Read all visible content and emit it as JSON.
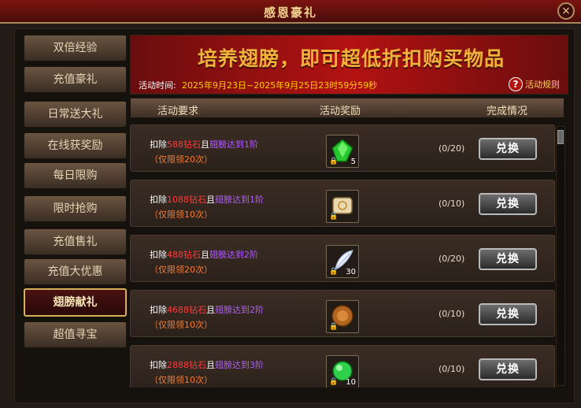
{
  "window": {
    "title": "感恩豪礼",
    "close_label": "×"
  },
  "sidebar": {
    "items": [
      {
        "label": "双倍经验",
        "active": false
      },
      {
        "label": "充值豪礼",
        "active": false
      },
      {
        "label": "日常送大礼",
        "active": false
      },
      {
        "label": "在线获奖励",
        "active": false
      },
      {
        "label": "每日限购",
        "active": false
      },
      {
        "label": "限时抢购",
        "active": false
      },
      {
        "label": "充值售礼",
        "active": false
      },
      {
        "label": "充值大优惠",
        "active": false
      },
      {
        "label": "翅膀献礼",
        "active": true
      },
      {
        "label": "超值寻宝",
        "active": false
      }
    ]
  },
  "banner": {
    "headline": "培养翅膀，即可超低折扣购买物品",
    "time_label": "活动时间:",
    "time_value": "2025年9月23日~2025年9月25日23时59分59秒",
    "rules_label": "活动规则",
    "rules_icon": "question-icon"
  },
  "columns": {
    "requirement": "活动要求",
    "reward": "活动奖励",
    "status": "完成情况"
  },
  "rows": [
    {
      "prefix": "扣除",
      "amount": "588钻石",
      "mid": "且",
      "wing": "翅膀达到1阶",
      "limit": "（仅限领20次）",
      "reward_icon": "green-gem-icon",
      "reward_count": "5",
      "progress": "(0/20)",
      "button": "兑换"
    },
    {
      "prefix": "扣除",
      "amount": "1088钻石",
      "mid": "且",
      "wing": "翅膀达到1阶",
      "limit": "（仅限领10次）",
      "reward_icon": "scroll-icon",
      "reward_count": "",
      "progress": "(0/10)",
      "button": "兑换"
    },
    {
      "prefix": "扣除",
      "amount": "488钻石",
      "mid": "且",
      "wing": "翅膀达到2阶",
      "limit": "（仅限领20次）",
      "reward_icon": "feather-icon",
      "reward_count": "30",
      "progress": "(0/20)",
      "button": "兑换"
    },
    {
      "prefix": "扣除",
      "amount": "4688钻石",
      "mid": "且",
      "wing": "翅膀达到2阶",
      "limit": "（仅限领10次）",
      "reward_icon": "bronze-coin-icon",
      "reward_count": "",
      "progress": "(0/10)",
      "button": "兑换"
    },
    {
      "prefix": "扣除",
      "amount": "2888钻石",
      "mid": "且",
      "wing": "翅膀达到3阶",
      "limit": "（仅限领10次）",
      "reward_icon": "green-orb-icon",
      "reward_count": "10",
      "progress": "(0/10)",
      "button": "兑换"
    }
  ],
  "colors": {
    "accent_gold": "#f0b23a",
    "amount_red": "#ff3b3b",
    "wing_purple": "#b25cff",
    "limit_orange": "#ff7a2a"
  }
}
